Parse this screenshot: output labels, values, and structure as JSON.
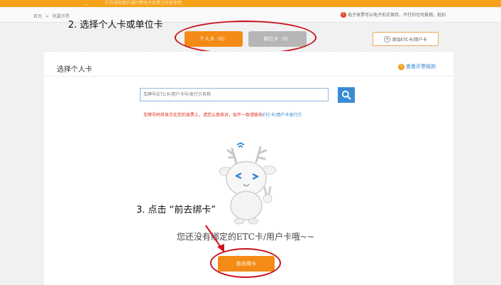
{
  "topbar": {
    "dots": "...",
    "ticker": "沪苏浙皖赣沪通行费电子发票已开放使用"
  },
  "breadcrumb": {
    "home": "首页",
    "sep": ">",
    "current": "我要开票"
  },
  "notice": {
    "icon": "!",
    "text": "电子发票可以电子形式保存，不打印也可报销，抵扣"
  },
  "annotations": {
    "step2": "2. 选择个人卡或单位卡",
    "step3": "3. 点击 “前去绑卡”"
  },
  "tabs": {
    "personal": "个人卡（0）",
    "unit": "单位卡（0）"
  },
  "add_button": {
    "icon": "+",
    "label": "添加ETC卡/用户卡"
  },
  "card": {
    "title": "选择个人卡",
    "rule_link": "查看开票规则",
    "rule_icon": "?"
  },
  "search": {
    "placeholder": "车牌号/ETC卡/用户卡号/发行方名称"
  },
  "hint": {
    "text": "车牌号码将显示在您的发票上，请您认真核对，如不一致请联系",
    "link": "ETC卡/用户卡发行方"
  },
  "empty_state": {
    "text": "您还没有绑定的ETC卡/用户卡哦~~"
  },
  "bind_button": {
    "label": "前去绑卡"
  },
  "colors": {
    "brand_orange": "#f48b16",
    "annotation_red": "#c9141e",
    "link_blue": "#2f7fd0",
    "search_blue": "#3b8bd4"
  }
}
